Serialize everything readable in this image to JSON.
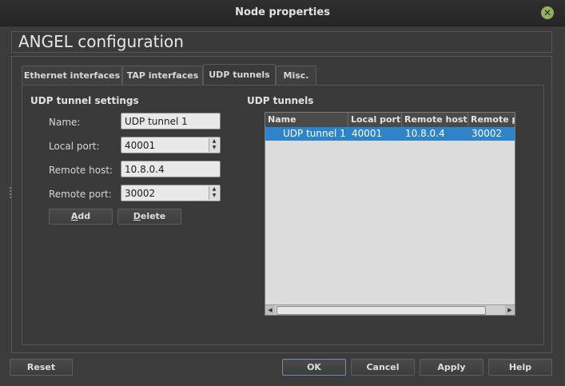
{
  "window": {
    "title": "Node properties"
  },
  "header": {
    "title": "ANGEL configuration"
  },
  "tabs": [
    {
      "label": "Ethernet interfaces"
    },
    {
      "label": "TAP interfaces"
    },
    {
      "label": "UDP tunnels"
    },
    {
      "label": "Misc."
    }
  ],
  "settings": {
    "section_title": "UDP tunnel settings",
    "name_label": "Name:",
    "name_value": "UDP tunnel 1",
    "local_port_label": "Local port:",
    "local_port_value": "40001",
    "remote_host_label": "Remote host:",
    "remote_host_value": "10.8.0.4",
    "remote_port_label": "Remote port:",
    "remote_port_value": "30002",
    "add_prefix": "",
    "add_underlined": "A",
    "add_rest": "dd",
    "delete_prefix": "",
    "delete_underlined": "D",
    "delete_rest": "elete"
  },
  "tunnels": {
    "section_title": "UDP tunnels",
    "columns": [
      "Name",
      "Local port",
      "Remote host",
      "Remote po"
    ],
    "rows": [
      {
        "name": "UDP tunnel 1",
        "local_port": "40001",
        "remote_host": "10.8.0.4",
        "remote_port": "30002"
      }
    ]
  },
  "footer": {
    "reset": "Reset",
    "ok": "OK",
    "cancel": "Cancel",
    "apply": "Apply",
    "help": "Help"
  }
}
